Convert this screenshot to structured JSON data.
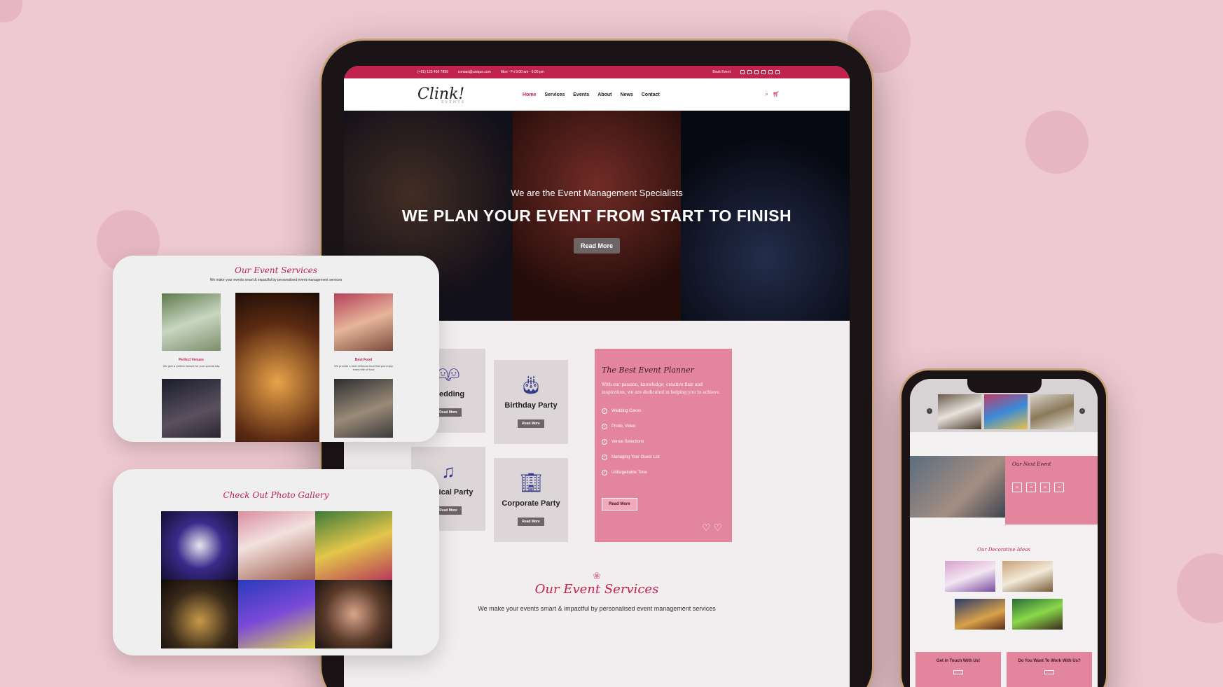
{
  "colors": {
    "accent": "#c0244d",
    "pink_panel": "#e3859d",
    "background": "#efc9d1",
    "button_gray": "#6e6466"
  },
  "topbar": {
    "phone": "(+91) 123 456 7899",
    "email": "contact@unique.com",
    "hours": "Mon - Fri 9.00 am - 6.00 pm",
    "book_event": "Book Event"
  },
  "brand": {
    "logo_text": "Clink!",
    "logo_sub": "EVENTS"
  },
  "nav": {
    "items": [
      "Home",
      "Services",
      "Events",
      "About",
      "News",
      "Contact"
    ],
    "active": "Home"
  },
  "hero": {
    "subtitle": "We are the Event Management Specialists",
    "title": "WE PLAN YOUR EVENT FROM START TO FINISH",
    "button": "Read More"
  },
  "service_cards": [
    {
      "title": "Wedding",
      "button": "Read More",
      "icon": "couple-icon"
    },
    {
      "title": "Birthday Party",
      "button": "Read More",
      "icon": "cake-icon"
    },
    {
      "title": "Musical Party",
      "button": "Read More",
      "icon": "dancers-icon"
    },
    {
      "title": "Corporate Party",
      "button": "Read More",
      "icon": "buildings-icon"
    }
  ],
  "planner": {
    "title": "The Best Event Planner",
    "text": "With our passion, knowledge, creative flair and inspiration, we are dedicated in helping you to achieve.",
    "items": [
      "Wedding Cakes",
      "Photo, Video",
      "Venue Selections",
      "Managing Your Guest List",
      "Unforgettable Time"
    ],
    "button": "Read More"
  },
  "services_section": {
    "title": "Our Event Services",
    "subtitle": "We make your events smart & impactful by personalised event management services"
  },
  "float_services": {
    "title": "Our Event Services",
    "subtitle": "We make your events smart & impactful by personalised event management services",
    "venues_title": "Perfect Venues",
    "venues_text": "We give a perfect venues for your special day",
    "food_title": "Best Food",
    "food_text": "We provide a best delicious food that you enjoy every bite of food"
  },
  "float_gallery": {
    "title": "Check Out Photo Gallery"
  },
  "phone": {
    "next_event_title": "Our Next Event",
    "countdown": [
      "00",
      "15",
      "40",
      "16"
    ],
    "deco_title": "Our Decorative Ideas",
    "contact_title": "Get in Touch With Us!",
    "work_title": "Do You Want To Work With Us?"
  }
}
